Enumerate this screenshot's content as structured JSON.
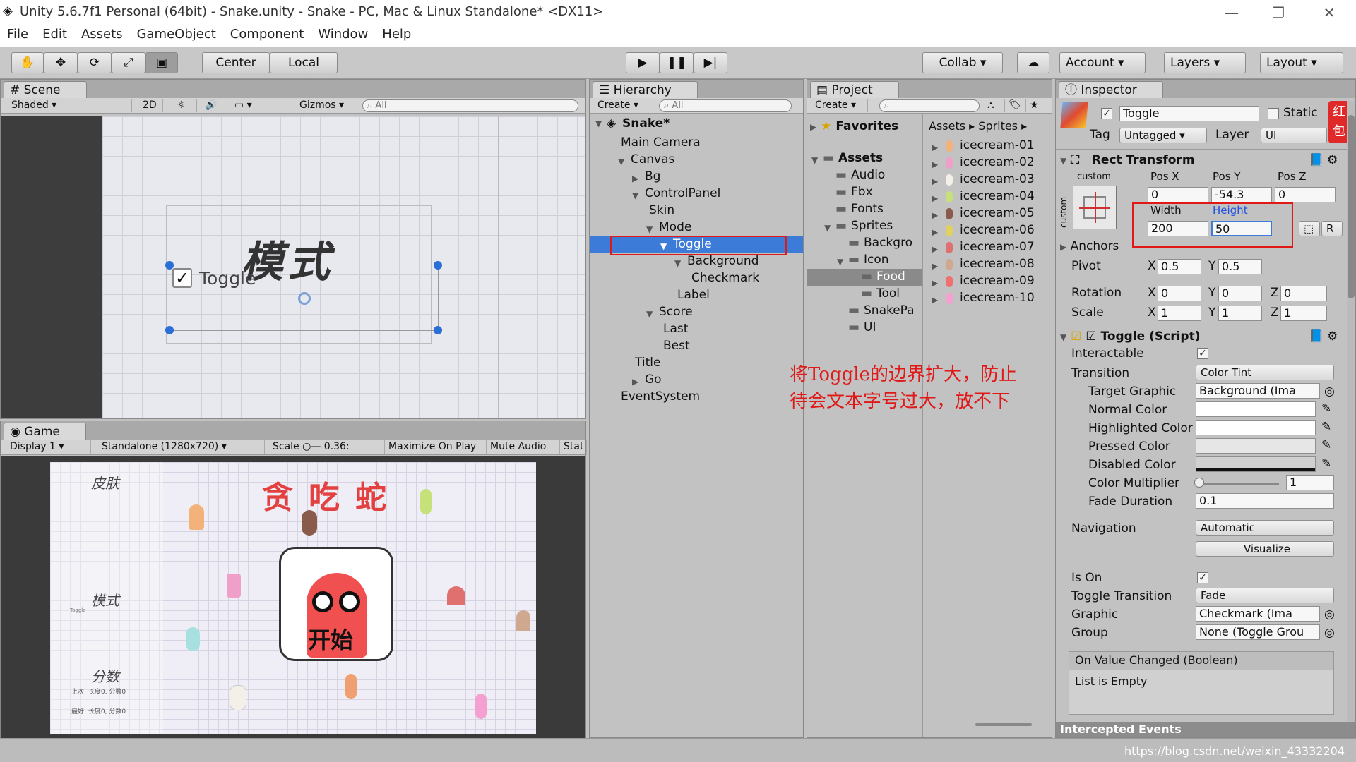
{
  "window": {
    "title": "Unity 5.6.7f1 Personal (64bit) - Snake.unity - Snake - PC, Mac & Linux Standalone* <DX11>",
    "minimize": "—",
    "restore": "❐",
    "close": "✕"
  },
  "menu": [
    "File",
    "Edit",
    "Assets",
    "GameObject",
    "Component",
    "Window",
    "Help"
  ],
  "toolbar": {
    "center": "Center",
    "local": "Local",
    "collab": "Collab ▾",
    "account": "Account",
    "layers": "Layers",
    "layout": "Layout"
  },
  "scene": {
    "tab": "Scene",
    "shaded": "Shaded",
    "mode2d": "2D",
    "gizmos": "Gizmos ▾",
    "search": "All",
    "title_text": "模式",
    "toggle_label": "Toggle"
  },
  "game": {
    "tab": "Game",
    "display": "Display 1",
    "resolution": "Standalone (1280x720)",
    "scale_label": "Scale",
    "scale_value": "0.36:",
    "maximize": "Maximize On Play",
    "mute": "Mute Audio",
    "stats": "Stat",
    "skin": "皮肤",
    "mode": "模式",
    "toggle_small": "Toggle",
    "score": "分数",
    "last": "上次: 长度0, 分数0",
    "best": "最好: 长度0, 分数0",
    "game_title": "贪吃蛇",
    "start": "开始"
  },
  "hierarchy": {
    "tab": "Hierarchy",
    "create": "Create ▾",
    "search": "All",
    "scene": "Snake*",
    "items": [
      {
        "label": "Main Camera",
        "indent": 0,
        "arrow": ""
      },
      {
        "label": "Canvas",
        "indent": 0,
        "arrow": "▼"
      },
      {
        "label": "Bg",
        "indent": 1,
        "arrow": "▶"
      },
      {
        "label": "ControlPanel",
        "indent": 1,
        "arrow": "▼"
      },
      {
        "label": "Skin",
        "indent": 2,
        "arrow": ""
      },
      {
        "label": "Mode",
        "indent": 2,
        "arrow": "▼"
      },
      {
        "label": "Toggle",
        "indent": 3,
        "arrow": "▼",
        "selected": true
      },
      {
        "label": "Background",
        "indent": 4,
        "arrow": "▼"
      },
      {
        "label": "Checkmark",
        "indent": 5,
        "arrow": ""
      },
      {
        "label": "Label",
        "indent": 4,
        "arrow": ""
      },
      {
        "label": "Score",
        "indent": 2,
        "arrow": "▼"
      },
      {
        "label": "Last",
        "indent": 3,
        "arrow": ""
      },
      {
        "label": "Best",
        "indent": 3,
        "arrow": ""
      },
      {
        "label": "Title",
        "indent": 1,
        "arrow": ""
      },
      {
        "label": "Go",
        "indent": 1,
        "arrow": "▶"
      },
      {
        "label": "EventSystem",
        "indent": 0,
        "arrow": ""
      }
    ]
  },
  "project": {
    "tab": "Project",
    "create": "Create ▾",
    "favorites": "Favorites",
    "breadcrumb": [
      "Assets",
      "Sprites"
    ],
    "folders": [
      {
        "label": "Assets",
        "indent": 0,
        "arrow": "▼",
        "bold": true
      },
      {
        "label": "Audio",
        "indent": 1,
        "arrow": ""
      },
      {
        "label": "Fbx",
        "indent": 1,
        "arrow": ""
      },
      {
        "label": "Fonts",
        "indent": 1,
        "arrow": ""
      },
      {
        "label": "Sprites",
        "indent": 1,
        "arrow": "▼"
      },
      {
        "label": "Backgro",
        "indent": 2,
        "arrow": ""
      },
      {
        "label": "Icon",
        "indent": 2,
        "arrow": "▼"
      },
      {
        "label": "Food",
        "indent": 3,
        "arrow": "",
        "selected": true
      },
      {
        "label": "Tool",
        "indent": 3,
        "arrow": ""
      },
      {
        "label": "SnakePa",
        "indent": 2,
        "arrow": ""
      },
      {
        "label": "UI",
        "indent": 2,
        "arrow": ""
      }
    ],
    "assets": [
      "icecream-01",
      "icecream-02",
      "icecream-03",
      "icecream-04",
      "icecream-05",
      "icecream-06",
      "icecream-07",
      "icecream-08",
      "icecream-09",
      "icecream-10"
    ]
  },
  "inspector": {
    "tab": "Inspector",
    "name": "Toggle",
    "static": "Static",
    "tag_label": "Tag",
    "tag": "Untagged",
    "layer_label": "Layer",
    "layer": "UI",
    "rect": {
      "title": "Rect Transform",
      "custom": "custom",
      "posx_label": "Pos X",
      "posy_label": "Pos Y",
      "posz_label": "Pos Z",
      "posx": "0",
      "posy": "-54.3",
      "posz": "0",
      "width_label": "Width",
      "height_label": "Height",
      "width": "200",
      "height": "50",
      "r": "R",
      "anchors": "Anchors",
      "pivot": "Pivot",
      "pivot_x": "0.5",
      "pivot_y": "0.5",
      "rotation": "Rotation",
      "rot_x": "0",
      "rot_y": "0",
      "rot_z": "0",
      "scale": "Scale",
      "sc_x": "1",
      "sc_y": "1",
      "sc_z": "1",
      "x": "X",
      "y": "Y",
      "z": "Z",
      "side": "custom"
    },
    "toggle": {
      "title": "Toggle (Script)",
      "interactable": "Interactable",
      "transition": "Transition",
      "transition_val": "Color Tint",
      "target_graphic": "Target Graphic",
      "target_graphic_val": "Background (Ima",
      "normal": "Normal Color",
      "highlighted": "Highlighted Color",
      "pressed": "Pressed Color",
      "disabled": "Disabled Color",
      "multiplier": "Color Multiplier",
      "multiplier_val": "1",
      "fade": "Fade Duration",
      "fade_val": "0.1",
      "navigation": "Navigation",
      "navigation_val": "Automatic",
      "visualize": "Visualize",
      "ison": "Is On",
      "toggle_transition": "Toggle Transition",
      "toggle_transition_val": "Fade",
      "graphic": "Graphic",
      "graphic_val": "Checkmark (Ima",
      "group": "Group",
      "group_val": "None (Toggle Grou",
      "event": "On Value Changed (Boolean)",
      "list_empty": "List is Empty"
    },
    "intercepted": "Intercepted Events",
    "redbadge": "红包"
  },
  "annotation": {
    "line1": "将Toggle的边界扩大，防止",
    "line2": "待会文本字号过大，放不下"
  },
  "watermark": "https://blog.csdn.net/weixin_43332204",
  "colors": {
    "selection": "#3d7bd9",
    "highlight_red": "#e01818",
    "accent_blue": "#2050e0"
  }
}
